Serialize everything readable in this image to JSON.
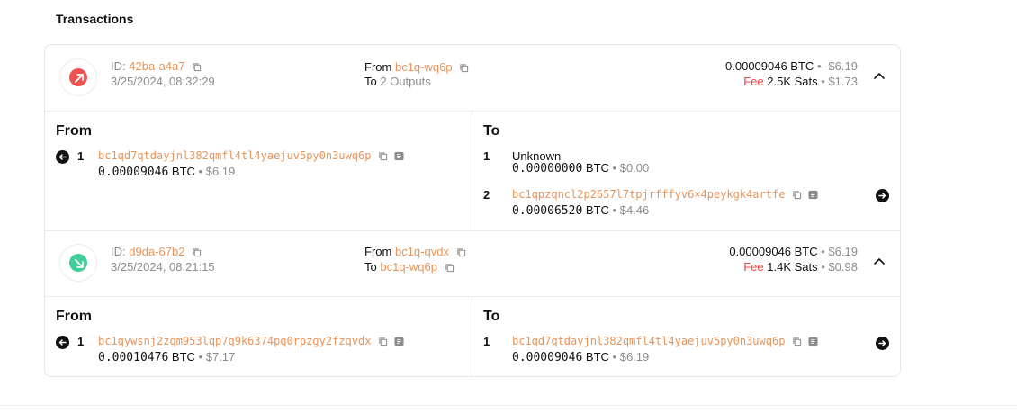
{
  "section_title": "Transactions",
  "transactions": [
    {
      "direction": "outgoing",
      "badge_color": "#f05252",
      "id_label": "ID:",
      "id": "42ba-a4a7",
      "date": "3/25/2024, 08:32:29",
      "from_label": "From",
      "from": "bc1q-wq6p",
      "to_label": "To",
      "to": "2 Outputs",
      "amount_btc": "-0.00009046 BTC",
      "amount_usd": "-$6.19",
      "fee_label": "Fee",
      "fee_sats": "2.5K Sats",
      "fee_usd": "$1.73",
      "details": {
        "from_heading": "From",
        "to_heading": "To",
        "inputs": [
          {
            "index": "1",
            "address": "bc1qd7qtdayjnl382qmfl4tl4yaejuv5py0n3uwq6p",
            "btc_value": "0.00009046",
            "unit": "BTC",
            "usd": "$6.19"
          }
        ],
        "outputs": [
          {
            "index": "1",
            "label": "Unknown",
            "btc_value": "0.00000000",
            "unit": "BTC",
            "usd": "$0.00"
          },
          {
            "index": "2",
            "address": "bc1qpzqncl2p2657l7tpjrfffyv6×4peykgk4artfe",
            "btc_value": "0.00006520",
            "unit": "BTC",
            "usd": "$4.46"
          }
        ]
      }
    },
    {
      "direction": "incoming",
      "badge_color": "#3ecf9a",
      "id_label": "ID:",
      "id": "d9da-67b2",
      "date": "3/25/2024, 08:21:15",
      "from_label": "From",
      "from": "bc1q-qvdx",
      "to_label": "To",
      "to": "bc1q-wq6p",
      "amount_btc": "0.00009046 BTC",
      "amount_usd": "$6.19",
      "fee_label": "Fee",
      "fee_sats": "1.4K Sats",
      "fee_usd": "$0.98",
      "details": {
        "from_heading": "From",
        "to_heading": "To",
        "inputs": [
          {
            "index": "1",
            "address": "bc1qywsnj2zqm953lqp7q9k6374pq0rpzgy2fzqvdx",
            "btc_value": "0.00010476",
            "unit": "BTC",
            "usd": "$7.17"
          }
        ],
        "outputs": [
          {
            "index": "1",
            "address": "bc1qd7qtdayjnl382qmfl4tl4yaejuv5py0n3uwq6p",
            "btc_value": "0.00009046",
            "unit": "BTC",
            "usd": "$6.19"
          }
        ]
      }
    }
  ],
  "separator": "•"
}
